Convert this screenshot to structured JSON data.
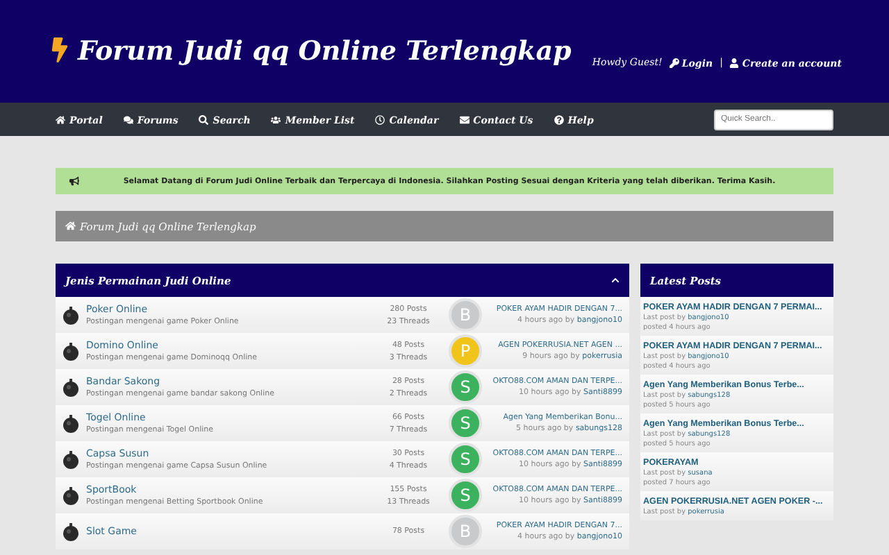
{
  "header": {
    "title": "Forum Judi qq Online Terlengkap",
    "greeting": "Howdy Guest!",
    "login": "Login",
    "separator": "|",
    "register": "Create an account"
  },
  "nav": {
    "items": [
      {
        "label": "Portal"
      },
      {
        "label": "Forums"
      },
      {
        "label": "Search"
      },
      {
        "label": "Member List"
      },
      {
        "label": "Calendar"
      },
      {
        "label": "Contact Us"
      },
      {
        "label": "Help"
      }
    ],
    "search_placeholder": "Quick Search.."
  },
  "notice": "Selamat Datang di Forum Judi Online Terbaik dan Terpercaya di Indonesia. Silahkan Posting Sesuai dengan Kriteria yang telah diberikan. Terima Kasih.",
  "breadcrumb": "Forum Judi qq Online Terlengkap",
  "category": {
    "title": "Jenis Permainan Judi Online",
    "expanded": true,
    "forums": [
      {
        "name": "Poker Online",
        "description": "Postingan mengenai game Poker Online",
        "posts": "280 Posts",
        "threads": "23 Threads",
        "avatar": "B",
        "color": "#c8cacc",
        "last_title": "POKER AYAM HADIR DENGAN 7...",
        "when": "4 hours ago by",
        "user": "bangjono10"
      },
      {
        "name": "Domino Online",
        "description": "Postingan mengenai game Dominoqq Online",
        "posts": "48 Posts",
        "threads": "3 Threads",
        "avatar": "P",
        "color": "#f0c419",
        "last_title": "AGEN POKERRUSIA.NET AGEN ...",
        "when": "9 hours ago by",
        "user": "pokerrusia"
      },
      {
        "name": "Bandar Sakong",
        "description": "Postingan mengenai game bandar sakong Online",
        "posts": "28 Posts",
        "threads": "2 Threads",
        "avatar": "S",
        "color": "#3cb25e",
        "last_title": "OKTO88.COM AMAN DAN TERPE...",
        "when": "10 hours ago by",
        "user": "Santi8899"
      },
      {
        "name": "Togel Online",
        "description": "Postingan mengenai Togel Online",
        "posts": "66 Posts",
        "threads": "7 Threads",
        "avatar": "S",
        "color": "#3cb25e",
        "last_title": "Agen Yang Memberikan Bonu...",
        "when": "5 hours ago by",
        "user": "sabungs128"
      },
      {
        "name": "Capsa Susun",
        "description": "Postingan mengenai game Capsa Susun Online",
        "posts": "30 Posts",
        "threads": "4 Threads",
        "avatar": "S",
        "color": "#3cb25e",
        "last_title": "OKTO88.COM AMAN DAN TERPE...",
        "when": "10 hours ago by",
        "user": "Santi8899"
      },
      {
        "name": "SportBook",
        "description": "Postingan mengenai Betting Sportbook Online",
        "posts": "155 Posts",
        "threads": "13 Threads",
        "avatar": "S",
        "color": "#3cb25e",
        "last_title": "OKTO88.COM AMAN DAN TERPE...",
        "when": "10 hours ago by",
        "user": "Santi8899"
      },
      {
        "name": "Slot Game",
        "posts": "78 Posts",
        "avatar": "B",
        "color": "#c8cacc",
        "last_title": "POKER AYAM HADIR DENGAN 7...",
        "when": "4 hours ago by",
        "user": "bangjono10"
      }
    ]
  },
  "latest": {
    "title": "Latest Posts",
    "posts": [
      {
        "title": "POKER AYAM HADIR DENGAN 7 PERMAI...",
        "by": "Last post by",
        "user": "bangjono10",
        "posted": "posted 4 hours ago"
      },
      {
        "title": "POKER AYAM HADIR DENGAN 7 PERMAI...",
        "by": "Last post by",
        "user": "bangjono10",
        "posted": "posted 4 hours ago"
      },
      {
        "title": "Agen Yang Memberikan Bonus Terbe...",
        "by": "Last post by",
        "user": "sabungs128",
        "posted": "posted 5 hours ago"
      },
      {
        "title": "Agen Yang Memberikan Bonus Terbe...",
        "by": "Last post by",
        "user": "sabungs128",
        "posted": "posted 5 hours ago"
      },
      {
        "title": "POKERAYAM",
        "by": "Last post by",
        "user": "susana",
        "posted": "posted 7 hours ago"
      },
      {
        "title": "AGEN POKERRUSIA.NET AGEN POKER -...",
        "by": "Last post by",
        "user": "pokerrusia"
      }
    ]
  }
}
